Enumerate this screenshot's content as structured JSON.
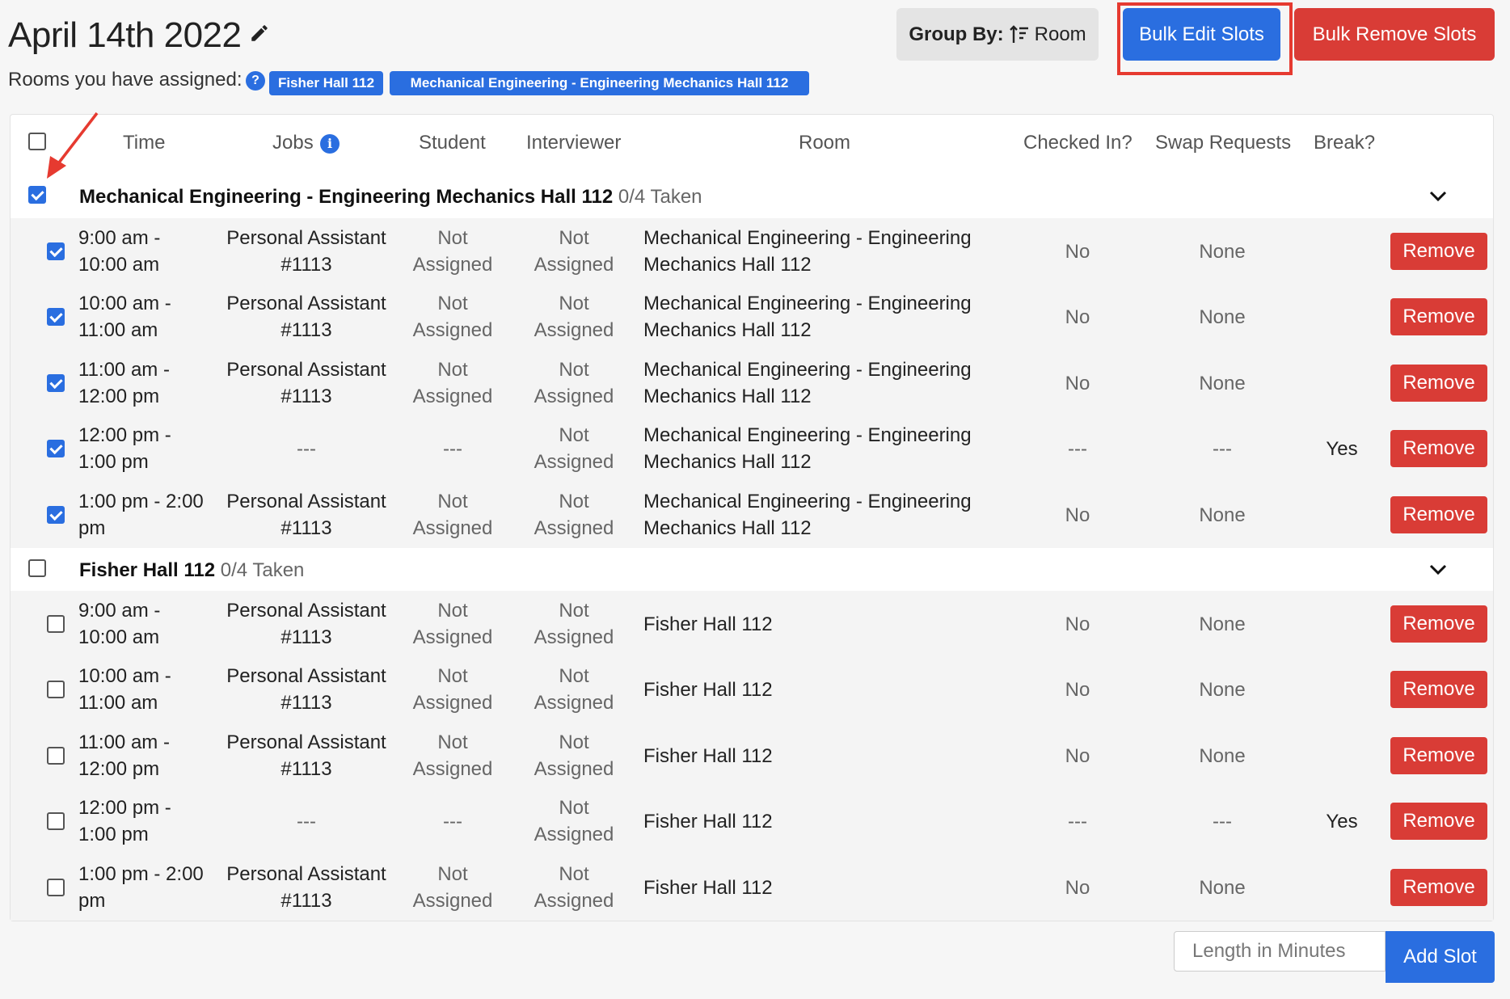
{
  "header": {
    "title": "April 14th 2022",
    "rooms_label": "Rooms you have assigned:",
    "room_badges": [
      "Fisher Hall 112",
      "Mechanical Engineering - Engineering Mechanics Hall 112"
    ],
    "group_by_label": "Group By:",
    "group_by_value": "Room",
    "bulk_edit_label": "Bulk Edit Slots",
    "bulk_remove_label": "Bulk Remove Slots"
  },
  "table": {
    "columns": [
      "Time",
      "Jobs",
      "Student",
      "Interviewer",
      "Room",
      "Checked In?",
      "Swap Requests",
      "Break?"
    ],
    "remove_label": "Remove"
  },
  "groups": [
    {
      "name": "Mechanical Engineering - Engineering Mechanics Hall 112",
      "count": "0/4 Taken",
      "checked": true,
      "rows": [
        {
          "time": [
            "9:00 am -",
            "10:00 am"
          ],
          "job": [
            "Personal Assistant",
            "#1113"
          ],
          "student": [
            "Not",
            "Assigned"
          ],
          "interviewer": [
            "Not",
            "Assigned"
          ],
          "room": [
            "Mechanical Engineering - Engineering",
            "Mechanics Hall 112"
          ],
          "checked_in": "No",
          "swap": "None",
          "break": "",
          "checked": true
        },
        {
          "time": [
            "10:00 am -",
            "11:00 am"
          ],
          "job": [
            "Personal Assistant",
            "#1113"
          ],
          "student": [
            "Not",
            "Assigned"
          ],
          "interviewer": [
            "Not",
            "Assigned"
          ],
          "room": [
            "Mechanical Engineering - Engineering",
            "Mechanics Hall 112"
          ],
          "checked_in": "No",
          "swap": "None",
          "break": "",
          "checked": true
        },
        {
          "time": [
            "11:00 am -",
            "12:00 pm"
          ],
          "job": [
            "Personal Assistant",
            "#1113"
          ],
          "student": [
            "Not",
            "Assigned"
          ],
          "interviewer": [
            "Not",
            "Assigned"
          ],
          "room": [
            "Mechanical Engineering - Engineering",
            "Mechanics Hall 112"
          ],
          "checked_in": "No",
          "swap": "None",
          "break": "",
          "checked": true
        },
        {
          "time": [
            "12:00 pm -",
            "1:00 pm"
          ],
          "job": [
            "---"
          ],
          "student": [
            "---"
          ],
          "interviewer": [
            "Not",
            "Assigned"
          ],
          "room": [
            "Mechanical Engineering - Engineering",
            "Mechanics Hall 112"
          ],
          "checked_in": "---",
          "swap": "---",
          "break": "Yes",
          "checked": true
        },
        {
          "time": [
            "1:00 pm - 2:00",
            "pm"
          ],
          "job": [
            "Personal Assistant",
            "#1113"
          ],
          "student": [
            "Not",
            "Assigned"
          ],
          "interviewer": [
            "Not",
            "Assigned"
          ],
          "room": [
            "Mechanical Engineering - Engineering",
            "Mechanics Hall 112"
          ],
          "checked_in": "No",
          "swap": "None",
          "break": "",
          "checked": true
        }
      ]
    },
    {
      "name": "Fisher Hall 112",
      "count": "0/4 Taken",
      "checked": false,
      "rows": [
        {
          "time": [
            "9:00 am -",
            "10:00 am"
          ],
          "job": [
            "Personal Assistant",
            "#1113"
          ],
          "student": [
            "Not",
            "Assigned"
          ],
          "interviewer": [
            "Not",
            "Assigned"
          ],
          "room": [
            "Fisher Hall 112"
          ],
          "checked_in": "No",
          "swap": "None",
          "break": "",
          "checked": false
        },
        {
          "time": [
            "10:00 am -",
            "11:00 am"
          ],
          "job": [
            "Personal Assistant",
            "#1113"
          ],
          "student": [
            "Not",
            "Assigned"
          ],
          "interviewer": [
            "Not",
            "Assigned"
          ],
          "room": [
            "Fisher Hall 112"
          ],
          "checked_in": "No",
          "swap": "None",
          "break": "",
          "checked": false
        },
        {
          "time": [
            "11:00 am -",
            "12:00 pm"
          ],
          "job": [
            "Personal Assistant",
            "#1113"
          ],
          "student": [
            "Not",
            "Assigned"
          ],
          "interviewer": [
            "Not",
            "Assigned"
          ],
          "room": [
            "Fisher Hall 112"
          ],
          "checked_in": "No",
          "swap": "None",
          "break": "",
          "checked": false
        },
        {
          "time": [
            "12:00 pm -",
            "1:00 pm"
          ],
          "job": [
            "---"
          ],
          "student": [
            "---"
          ],
          "interviewer": [
            "Not",
            "Assigned"
          ],
          "room": [
            "Fisher Hall 112"
          ],
          "checked_in": "---",
          "swap": "---",
          "break": "Yes",
          "checked": false
        },
        {
          "time": [
            "1:00 pm - 2:00",
            "pm"
          ],
          "job": [
            "Personal Assistant",
            "#1113"
          ],
          "student": [
            "Not",
            "Assigned"
          ],
          "interviewer": [
            "Not",
            "Assigned"
          ],
          "room": [
            "Fisher Hall 112"
          ],
          "checked_in": "No",
          "swap": "None",
          "break": "",
          "checked": false
        }
      ]
    }
  ],
  "footer": {
    "length_placeholder": "Length in Minutes",
    "add_slot_label": "Add Slot"
  },
  "colors": {
    "primary": "#2a6ee0",
    "danger": "#d93c36",
    "highlight": "#e63a30"
  },
  "icons": [
    "pencil-icon",
    "help-icon",
    "info-icon",
    "sort-icon",
    "chevron-down-icon",
    "arrow-annotation"
  ]
}
